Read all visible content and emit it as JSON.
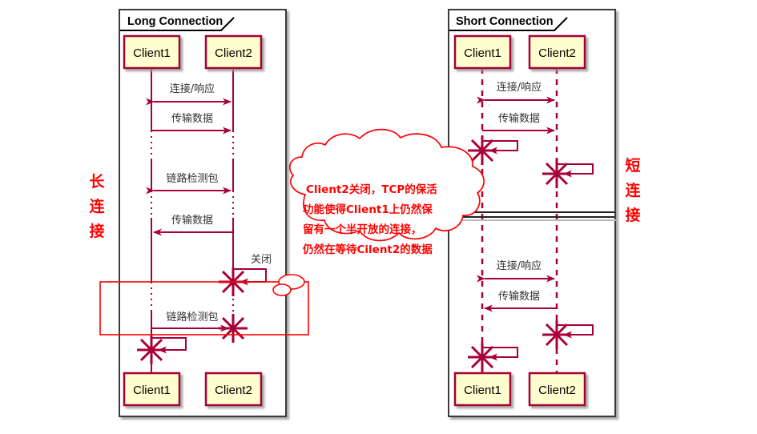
{
  "diagram": {
    "type": "uml-sequence-comparison",
    "colors": {
      "lifeline": "#A80036",
      "participant_fill": "#FEFECE",
      "participant_border": "#A80036",
      "frame_border": "#3A3A3A",
      "annotation_red": "#FF0000",
      "message_text": "#333333",
      "shadow": "#888888"
    },
    "side_labels": {
      "left": {
        "name": "long-connection-vertical-label",
        "chars": [
          "长",
          "连",
          "接"
        ]
      },
      "right": {
        "name": "short-connection-vertical-label",
        "chars": [
          "短",
          "连",
          "接"
        ]
      }
    },
    "frames": [
      {
        "id": "long",
        "title": "Long Connection",
        "participants_top": [
          "Client1",
          "Client2"
        ],
        "participants_bottom": [
          "Client1",
          "Client2"
        ],
        "messages": [
          {
            "label": "连接/响应",
            "direction": "both"
          },
          {
            "label": "传输数据",
            "direction": "right"
          },
          {
            "label": "链路检测包",
            "direction": "both"
          },
          {
            "label": "传输数据",
            "direction": "left"
          },
          {
            "label": "关闭",
            "direction": "destroy-right"
          },
          {
            "label": "链路检测包",
            "direction": "right-destroy"
          },
          {
            "label": "",
            "direction": "destroy-left"
          }
        ]
      },
      {
        "id": "short",
        "title": "Short Connection",
        "participants_top": [
          "Client1",
          "Client2"
        ],
        "participants_bottom": [
          "Client1",
          "Client2"
        ],
        "messages": [
          {
            "label": "连接/响应",
            "direction": "both"
          },
          {
            "label": "传输数据",
            "direction": "right"
          },
          {
            "label": "",
            "direction": "destroy-left"
          },
          {
            "label": "",
            "direction": "destroy-right"
          },
          {
            "label": "连接/响应",
            "direction": "both"
          },
          {
            "label": "传输数据",
            "direction": "left"
          },
          {
            "label": "",
            "direction": "destroy-right"
          },
          {
            "label": "",
            "direction": "destroy-left"
          }
        ],
        "divider": "delay-separator"
      }
    ],
    "callout": {
      "name": "thought-bubble-annotation",
      "lines": [
        "Client2关闭，TCP的保活",
        "功能使得Client1上仍然保",
        "留有一个半开放的连接，",
        "仍然在等待Cilent2的数据"
      ]
    },
    "highlight_box": {
      "name": "red-highlight-rectangle",
      "color": "#FF0000"
    }
  }
}
